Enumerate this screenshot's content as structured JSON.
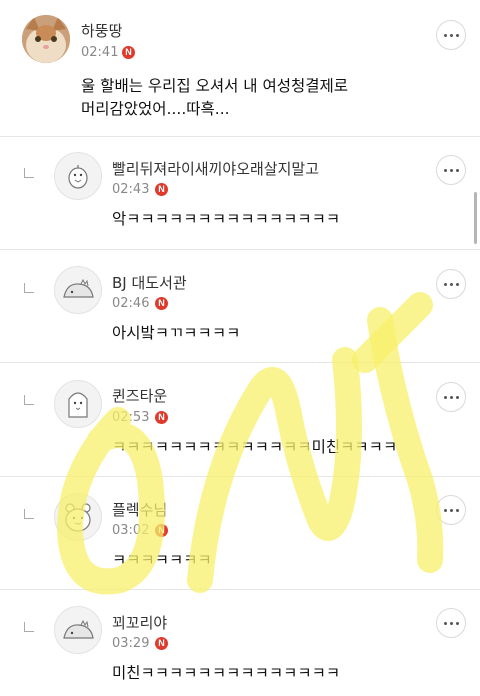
{
  "comments": [
    {
      "nickname": "하뚱땅",
      "time": "02:41",
      "badge": "N",
      "text_lines": [
        "울 할배는 우리집 오셔서 내 여성청결제로",
        "머리감았었어....따흑..."
      ]
    },
    {
      "nickname": "빨리뒤져라이새끼야오래살지말고",
      "time": "02:43",
      "badge": "N",
      "text_lines": [
        "악ㅋㅋㅋㅋㅋㅋㅋㅋㅋㅋㅋㅋㅋㅋㅋ"
      ]
    },
    {
      "nickname": "BJ 대도서관",
      "time": "02:46",
      "badge": "N",
      "text_lines": [
        "아시밬ㅋㄲㅋㅋㅋㅋ"
      ]
    },
    {
      "nickname": "퀸즈타운",
      "time": "02:53",
      "badge": "N",
      "text_lines": [
        "ㅋㅋㅋㅋㅋㅋㅋㅋㅋㅋㅋㅋㅋㅋ미친ㅋㅋㅋㅋ"
      ]
    },
    {
      "nickname": "플렉수님",
      "time": "03:02",
      "badge": "N",
      "text_lines": [
        "ㅋㅋㅋㅋㅋㅋㅋ"
      ]
    },
    {
      "nickname": "꾀꼬리야",
      "time": "03:29",
      "badge": "N",
      "text_lines": [
        "미친ㅋㅋㅋㅋㅋㅋㅋㅋㅋㅋㅋㅋㅋㅋ"
      ]
    }
  ],
  "colors": {
    "badge": "#e03a2d",
    "highlighter": "#f7f06a",
    "divider": "#e6e6e6"
  },
  "icons": {
    "more_button": "more-vertical-icon",
    "reply_marker": "reply-arrow-icon",
    "avatars": [
      "cat-photo",
      "chick-mascot-icon",
      "dino-mascot-icon",
      "penguin-mascot-icon",
      "bear-mascot-icon",
      "dino-mascot-icon"
    ]
  }
}
